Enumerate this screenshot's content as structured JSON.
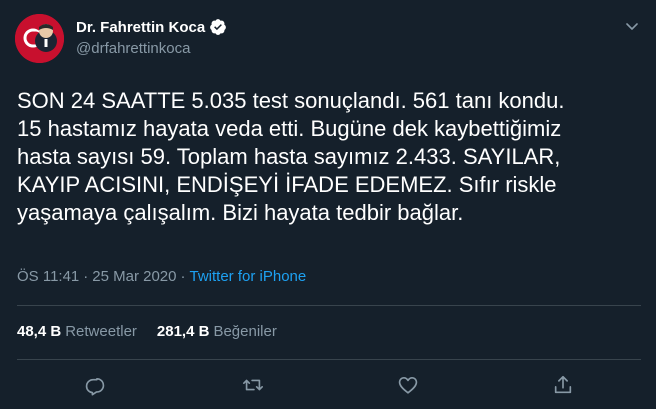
{
  "tweet": {
    "display_name": "Dr. Fahrettin Koca",
    "handle": "@drfahrettinkoca",
    "text": "SON 24 SAATTE 5.035 test sonuçlandı. 561 tanı kondu.\n15 hastamız hayata veda etti. Bugüne dek kaybettiğimiz\nhasta sayısı 59. Toplam hasta sayımız 2.433. SAYILAR,\nKAYIP ACISINI, ENDİŞEYİ İFADE EDEMEZ. Sıfır riskle\nyaşamaya çalışalım. Bizi hayata tedbir bağlar.",
    "time": "ÖS 11:41",
    "date": "25 Mar 2020",
    "separator": "·",
    "source": "Twitter for iPhone"
  },
  "stats": {
    "retweets_count": "48,4 B",
    "retweets_label": "Retweetler",
    "likes_count": "281,4 B",
    "likes_label": "Beğeniler"
  },
  "icons": {
    "verified": "verified-badge-icon",
    "more": "chevron-down-icon",
    "reply": "reply-icon",
    "retweet": "retweet-icon",
    "like": "heart-icon",
    "share": "share-icon"
  },
  "colors": {
    "background": "#15202b",
    "text": "#ffffff",
    "secondary": "#8899a6",
    "accent": "#1da1f2",
    "divider": "#38444d"
  }
}
